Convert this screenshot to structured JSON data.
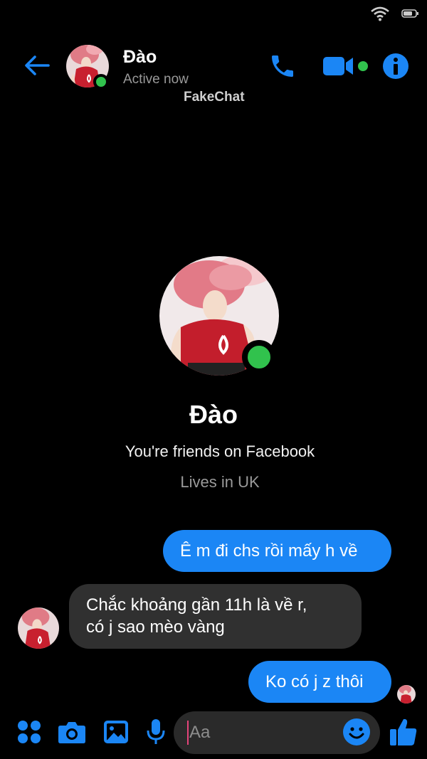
{
  "colors": {
    "accent": "#1b86f5",
    "online": "#31c24d",
    "incoming_bubble": "#303030",
    "background": "#000000"
  },
  "icons": {
    "status_wifi": "wifi-icon",
    "status_battery": "battery-icon",
    "back": "arrow-left-icon",
    "call": "phone-icon",
    "video": "video-camera-icon",
    "info": "info-icon",
    "apps": "four-dots-icon",
    "camera": "camera-icon",
    "gallery": "image-icon",
    "mic": "microphone-icon",
    "emoji": "smiley-icon",
    "like": "thumbs-up-icon"
  },
  "header": {
    "name": "Đào",
    "status": "Active now",
    "watermark": "FakeChat"
  },
  "profile": {
    "name": "Đào",
    "friends_text": "You're friends on Facebook",
    "location_text": "Lives in UK"
  },
  "messages": [
    {
      "direction": "outgoing",
      "lines": [
        "Ê m đi chs rồi mấy h về"
      ]
    },
    {
      "direction": "incoming",
      "lines": [
        "Chắc khoảng gần 11h là về r,",
        "có j sao mèo vàng"
      ]
    },
    {
      "direction": "outgoing",
      "lines": [
        "Ko có j z thôi"
      ]
    }
  ],
  "composer": {
    "placeholder": "Aa"
  }
}
